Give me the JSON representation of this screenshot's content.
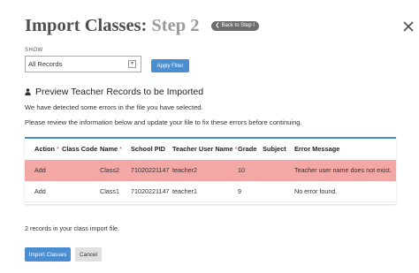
{
  "header": {
    "title_main": "Import Classes:",
    "title_step": "Step 2",
    "back_button_label": "Back to Step I",
    "back_icon": "chevron-left-icon",
    "close_icon": "close-icon"
  },
  "filter": {
    "show_label": "SHOW",
    "selected_option": "All Records",
    "dropdown_icon": "chevron-down-icon",
    "apply_label": "Apply Filter"
  },
  "preview": {
    "heading_icon": "user-icon",
    "heading": "Preview Teacher Records to be Imported",
    "message_errors": "We have detected some errors in the file you have selected.",
    "message_review": "Please review the information below and update your file to fix these errors before continuing."
  },
  "table": {
    "required_marker": "*",
    "columns": [
      {
        "label": "Action",
        "required": true
      },
      {
        "label": "Class Code",
        "required": false
      },
      {
        "label": "Name",
        "required": true
      },
      {
        "label": "School PID",
        "required": false
      },
      {
        "label": "Teacher User Name",
        "required": true
      },
      {
        "label": "Grade",
        "required": false
      },
      {
        "label": "Subject",
        "required": false
      },
      {
        "label": "Error Message",
        "required": false
      }
    ],
    "rows": [
      {
        "status": "error",
        "cells": [
          "Add",
          "",
          "Class2",
          "71020221147",
          "teacher2",
          "10",
          "",
          "Teacher user name does not exist."
        ]
      },
      {
        "status": "ok",
        "cells": [
          "Add",
          "",
          "Class1",
          "71020221147",
          "teacher1",
          "9",
          "",
          "No error found."
        ]
      }
    ]
  },
  "footer": {
    "records_count": "2 records in your class import file.",
    "import_label": "Import Classes",
    "cancel_label": "Cancel"
  },
  "colors": {
    "accent": "#4a8dd0",
    "error_row": "#f4a8a6",
    "required_marker": "#d33b3b",
    "back_button": "#6e6e6e"
  }
}
